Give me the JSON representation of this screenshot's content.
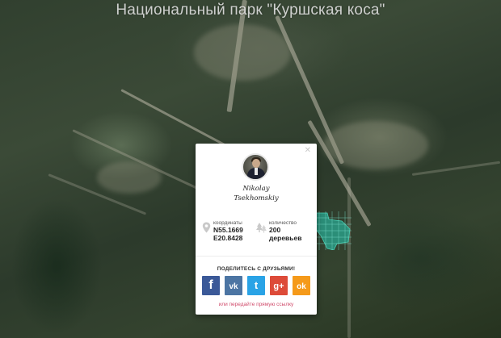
{
  "map": {
    "title": "Национальный парк \"Куршская коса\"",
    "highlight_color": "#2aa891"
  },
  "popup": {
    "close_icon": "close-icon",
    "name_line1": "Nikolay",
    "name_line2": "Tsekhomskiy",
    "coords_label": "координаты",
    "coords_lat": "N55.1669",
    "coords_lon": "E20.8428",
    "trees_label": "количество",
    "trees_count": "200",
    "trees_unit": "деревьев",
    "share_title": "ПОДЕЛИТЕСЬ С ДРУЗЬЯМИ!",
    "share_buttons": [
      {
        "label": "f",
        "icon": "facebook-icon",
        "color": "#3b5998"
      },
      {
        "label": "vk",
        "icon": "vk-icon",
        "color": "#4c75a3"
      },
      {
        "label": "t",
        "icon": "twitter-icon",
        "color": "#2aa3e6"
      },
      {
        "label": "g+",
        "icon": "google-plus-icon",
        "color": "#dd4b39"
      },
      {
        "label": "ok",
        "icon": "odnoklassniki-icon",
        "color": "#f59a1a"
      }
    ],
    "direct_link": "или передайте прямую ссылку"
  }
}
